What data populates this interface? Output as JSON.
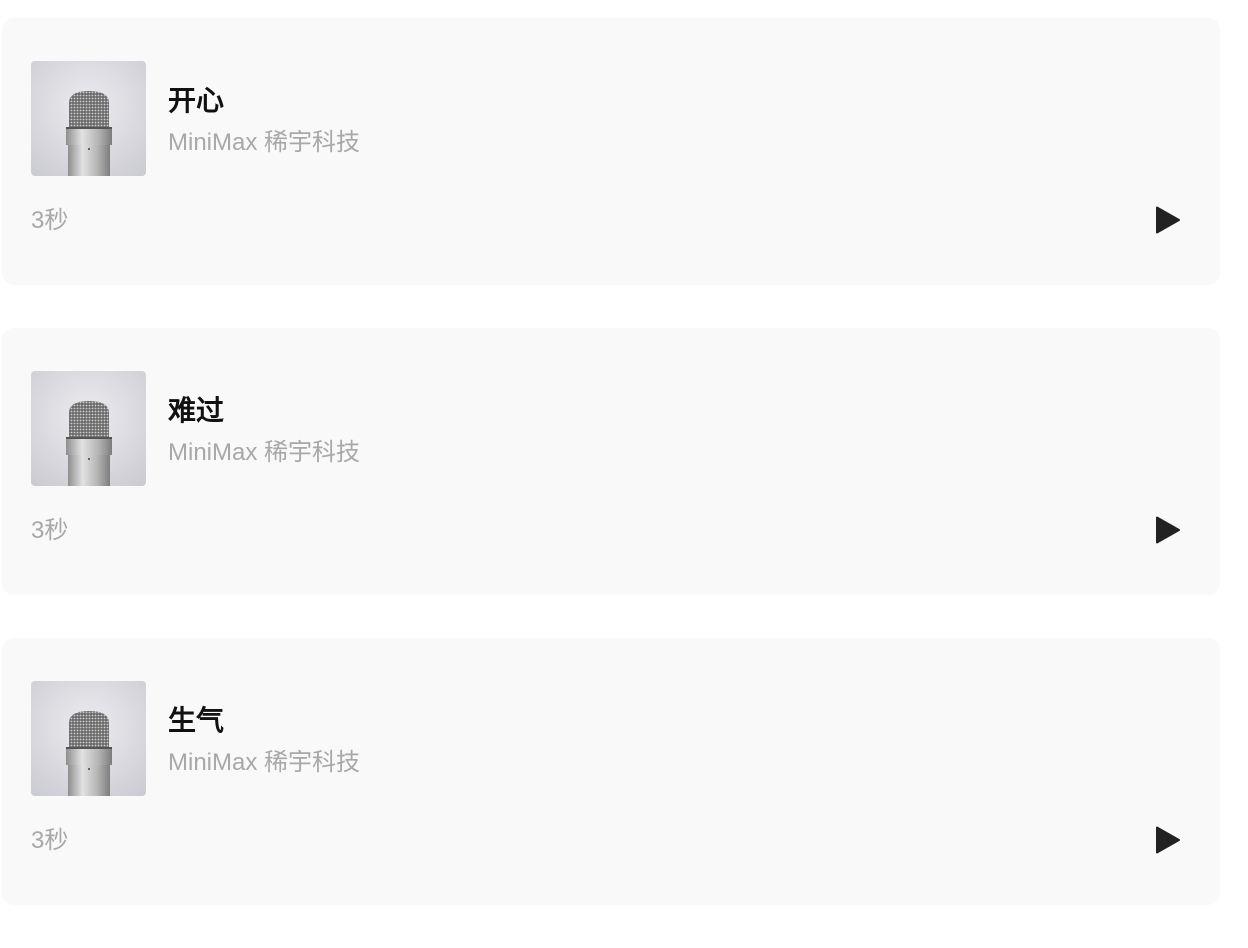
{
  "voices": [
    {
      "title": "开心",
      "author": "MiniMax 稀宇科技",
      "duration": "3秒",
      "thumbnail_icon": "microphone-icon",
      "action_icon": "play-icon"
    },
    {
      "title": "难过",
      "author": "MiniMax 稀宇科技",
      "duration": "3秒",
      "thumbnail_icon": "microphone-icon",
      "action_icon": "play-icon"
    },
    {
      "title": "生气",
      "author": "MiniMax 稀宇科技",
      "duration": "3秒",
      "thumbnail_icon": "microphone-icon",
      "action_icon": "play-icon"
    }
  ],
  "colors": {
    "card_background": "#f9f9f9",
    "title_text": "#111111",
    "secondary_text": "#a8a8a8",
    "play_icon": "#222222"
  }
}
